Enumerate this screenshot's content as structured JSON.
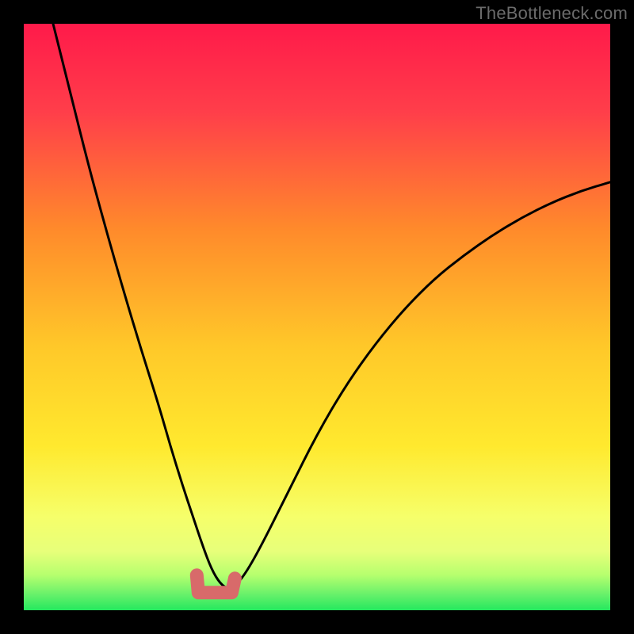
{
  "watermark": "TheBottleneck.com",
  "colors": {
    "background": "#000000",
    "gradient_top": "#ff1a4a",
    "gradient_mid1": "#ff8a2b",
    "gradient_mid2": "#ffe92e",
    "gradient_mid3": "#f6ff6a",
    "gradient_bottom": "#24e85e",
    "curve": "#000000",
    "marker": "#d86a6a"
  },
  "chart_data": {
    "type": "line",
    "title": "",
    "xlabel": "",
    "ylabel": "",
    "xlim": [
      0,
      100
    ],
    "ylim": [
      0,
      100
    ],
    "grid": false,
    "legend": false,
    "series": [
      {
        "name": "bottleneck-curve",
        "x": [
          5,
          8,
          11,
          14,
          17,
          20,
          23,
          25,
          27,
          29,
          30.5,
          32,
          33.5,
          35,
          37,
          40,
          45,
          50,
          55,
          60,
          65,
          70,
          75,
          80,
          85,
          90,
          95,
          100
        ],
        "y": [
          100,
          88,
          76,
          65,
          54.5,
          44.5,
          35,
          28,
          21.5,
          15.5,
          11,
          7,
          4.5,
          3.5,
          5,
          10,
          20,
          30,
          38.5,
          45.5,
          51.5,
          56.5,
          60.5,
          64,
          67,
          69.5,
          71.5,
          73
        ]
      }
    ],
    "optimal_zone": {
      "x_start": 29.5,
      "x_end": 36,
      "y": 3
    },
    "annotations": []
  }
}
